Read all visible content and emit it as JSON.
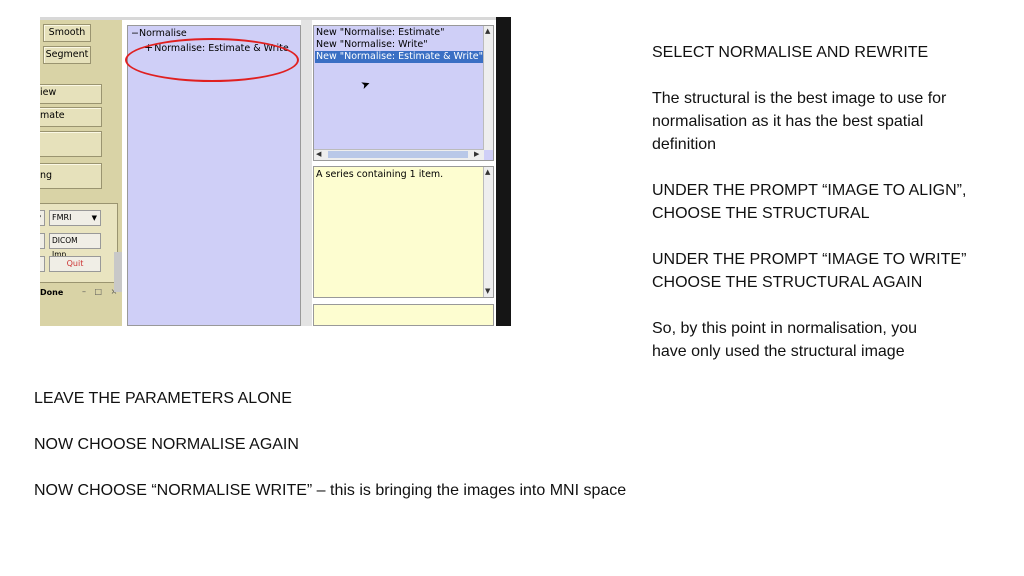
{
  "screenshot": {
    "left_menu": {
      "smooth": "Smooth",
      "segment": "Segment",
      "view": "iew",
      "estimate": "mate",
      "ng": "ng",
      "modality_select": "FMRI",
      "dicom_import": "DICOM Imp...",
      "quit": "Quit",
      "status": "Done",
      "win_controls": "– □ ×"
    },
    "batch_tree": {
      "root": "Normalise",
      "child": "Normalise: Estimate & Write"
    },
    "module_list": {
      "items": [
        "New \"Normalise: Estimate\"",
        "New \"Normalise: Write\"",
        "New \"Normalise: Estimate & Write\""
      ],
      "selected_index": 2
    },
    "info_text": "A series containing 1 item.",
    "colors": {
      "panel_blue": "#cfcff7",
      "panel_yellow": "#fdfdd0",
      "selection": "#3a6fc4",
      "annotation_red": "#e02020",
      "menu_beige": "#d9d3a6"
    }
  },
  "instructions_right": {
    "heading": "SELECT NORMALISE AND REWRITE",
    "p1_line1": "The structural is the best image to use for",
    "p1_line2": "normalisation as it has the best spatial",
    "p1_line3": "definition",
    "p2_line1": "UNDER THE PROMPT “IMAGE TO ALIGN”,",
    "p2_line2": "CHOOSE THE STRUCTURAL",
    "p3_line1": "UNDER THE PROMPT “IMAGE TO WRITE”",
    "p3_line2": "CHOOSE THE STRUCTURAL AGAIN",
    "p4_line1": "So, by this point in normalisation, you",
    "p4_line2": "have only used the structural image"
  },
  "instructions_bottom": {
    "line1": "LEAVE THE PARAMETERS ALONE",
    "line2": "NOW CHOOSE NORMALISE AGAIN",
    "line3": "NOW CHOOSE “NORMALISE WRITE” – this is bringing the images into MNI space"
  }
}
